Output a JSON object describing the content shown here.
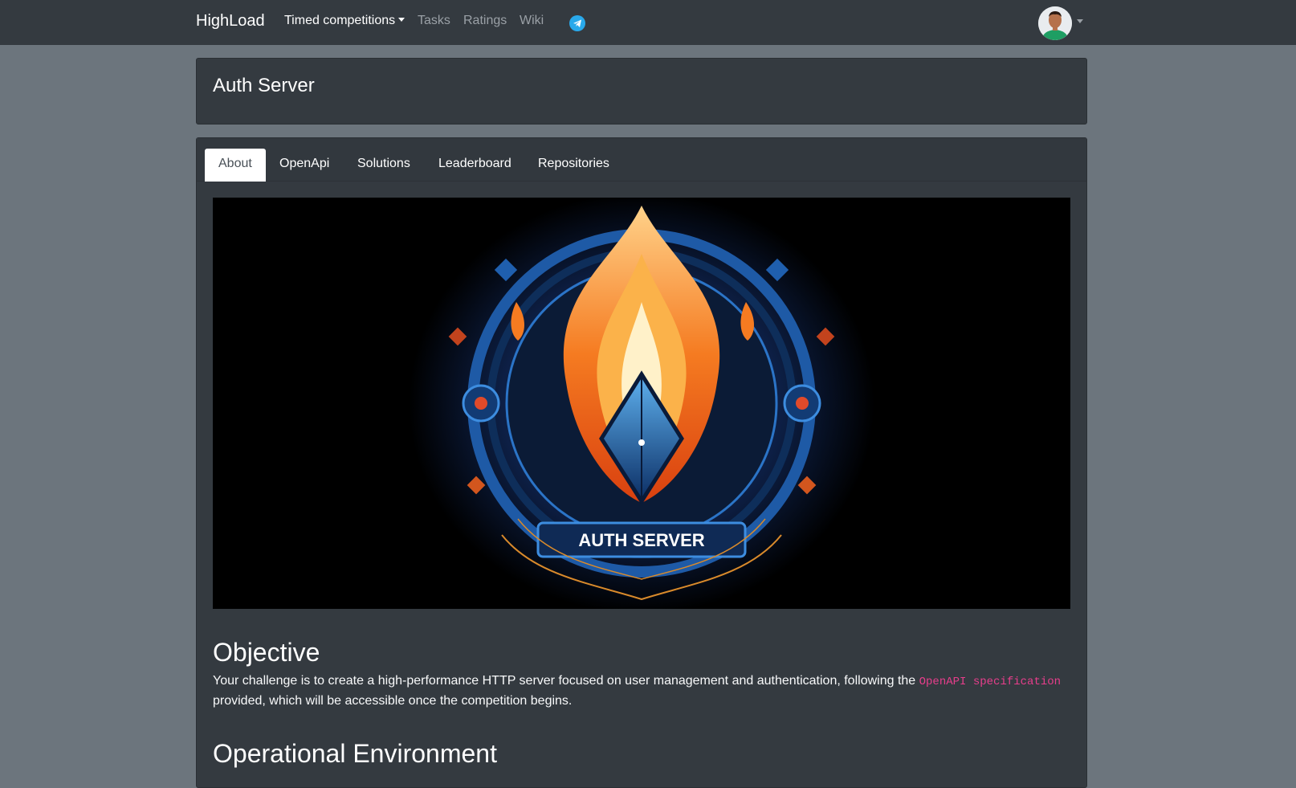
{
  "navbar": {
    "brand": "HighLoad",
    "links": [
      {
        "label": "Timed competitions"
      },
      {
        "label": "Tasks"
      },
      {
        "label": "Ratings"
      },
      {
        "label": "Wiki"
      }
    ],
    "telegram_icon": "telegram-icon",
    "avatar_icon": "user-avatar"
  },
  "header": {
    "title": "Auth Server"
  },
  "tabs": [
    {
      "label": "About",
      "active": true
    },
    {
      "label": "OpenApi"
    },
    {
      "label": "Solutions"
    },
    {
      "label": "Leaderboard"
    },
    {
      "label": "Repositories"
    }
  ],
  "hero": {
    "banner_text": "AUTH SERVER"
  },
  "content": {
    "objective_heading": "Objective",
    "objective_text_before": "Your challenge is to create a high-performance HTTP server focused on user management and authentication, following the ",
    "objective_code": "OpenAPI specification",
    "objective_text_after": " provided, which will be accessible once the competition begins.",
    "environment_heading": "Operational Environment"
  },
  "colors": {
    "page_bg": "#6c757d",
    "card_bg": "#343a40",
    "accent_code": "#e83e8c",
    "telegram": "#29a9eb"
  }
}
